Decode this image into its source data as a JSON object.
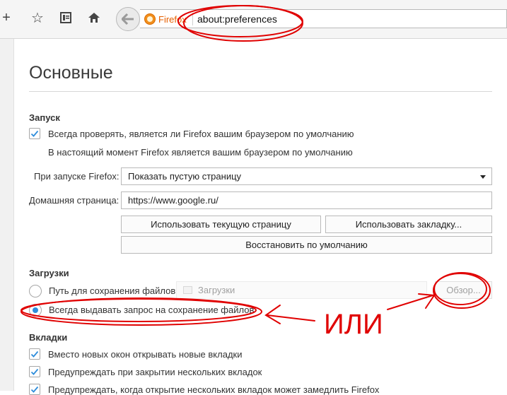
{
  "toolbar": {
    "new_tab_glyph": "+",
    "bookmark_glyph": "☆",
    "home_glyph": "⌂",
    "identity_label": "Firefox",
    "url": "about:preferences"
  },
  "page": {
    "title": "Основные"
  },
  "startup": {
    "heading": "Запуск",
    "always_check_label": "Всегда проверять, является ли Firefox вашим браузером по умолчанию",
    "always_check_checked": true,
    "default_status": "В настоящий момент Firefox является вашим браузером по умолчанию",
    "on_start_label": "При запуске Firefox:",
    "on_start_value": "Показать пустую страницу",
    "home_label": "Домашняя страница:",
    "home_value": "https://www.google.ru/",
    "use_current_button": "Использовать текущую страницу",
    "use_bookmark_button": "Использовать закладку...",
    "restore_default_button": "Восстановить по умолчанию"
  },
  "downloads": {
    "heading": "Загрузки",
    "save_path_label": "Путь для сохранения файлов",
    "save_path_value": "Загрузки",
    "browse_button": "Обзор...",
    "always_ask_label": "Всегда выдавать запрос на сохранение файлов",
    "selected_option": "always_ask"
  },
  "tabs": {
    "heading": "Вкладки",
    "items": [
      {
        "label": "Вместо новых окон открывать новые вкладки",
        "checked": true
      },
      {
        "label": "Предупреждать при закрытии нескольких вкладок",
        "checked": true
      },
      {
        "label": "Предупреждать, когда открытие нескольких вкладок может замедлить Firefox",
        "checked": true
      }
    ]
  },
  "annotation": {
    "text": "ИЛИ",
    "color": "#e00000"
  },
  "colors": {
    "accent": "#2e8ddb",
    "annotation_red": "#e00000",
    "firefox_orange": "#e66000"
  }
}
